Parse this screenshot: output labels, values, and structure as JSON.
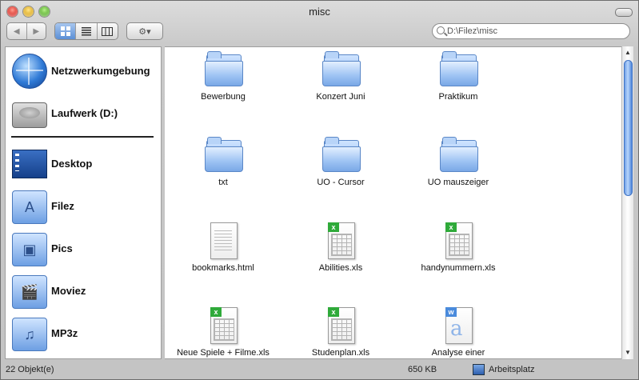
{
  "window": {
    "title": "misc"
  },
  "toolbar": {
    "back_label": "◀",
    "forward_label": "▶",
    "view_icons": [
      "icon-view-icon",
      "list-view-icon",
      "column-view-icon"
    ],
    "action_label": "⚙▾",
    "search_value": "D:\\Filez\\misc"
  },
  "sidebar": {
    "items": [
      {
        "label": "Netzwerkumgebung",
        "icon": "network-globe-icon"
      },
      {
        "label": "Laufwerk (D:)",
        "icon": "hard-drive-icon"
      },
      {
        "label": "Desktop",
        "icon": "desktop-icon"
      },
      {
        "label": "Filez",
        "icon": "applications-folder-icon"
      },
      {
        "label": "Pics",
        "icon": "pictures-folder-icon"
      },
      {
        "label": "Moviez",
        "icon": "movies-folder-icon"
      },
      {
        "label": "MP3z",
        "icon": "music-folder-icon"
      }
    ]
  },
  "files": [
    {
      "name": "Bewerbung",
      "type": "folder"
    },
    {
      "name": "Konzert Juni",
      "type": "folder"
    },
    {
      "name": "Praktikum",
      "type": "folder"
    },
    {
      "name": "txt",
      "type": "folder"
    },
    {
      "name": "UO - Cursor",
      "type": "folder"
    },
    {
      "name": "UO mauszeiger",
      "type": "folder"
    },
    {
      "name": "bookmarks.html",
      "type": "html"
    },
    {
      "name": "Abilities.xls",
      "type": "xls"
    },
    {
      "name": "handynummern.xls",
      "type": "xls"
    },
    {
      "name": "Neue Spiele + Filme.xls",
      "type": "xls"
    },
    {
      "name": "Studenplan.xls",
      "type": "xls"
    },
    {
      "name": "Analyse einer",
      "type": "text"
    }
  ],
  "status": {
    "count": "22 Objekt(e)",
    "size": "650 KB",
    "location": "Arbeitsplatz"
  }
}
